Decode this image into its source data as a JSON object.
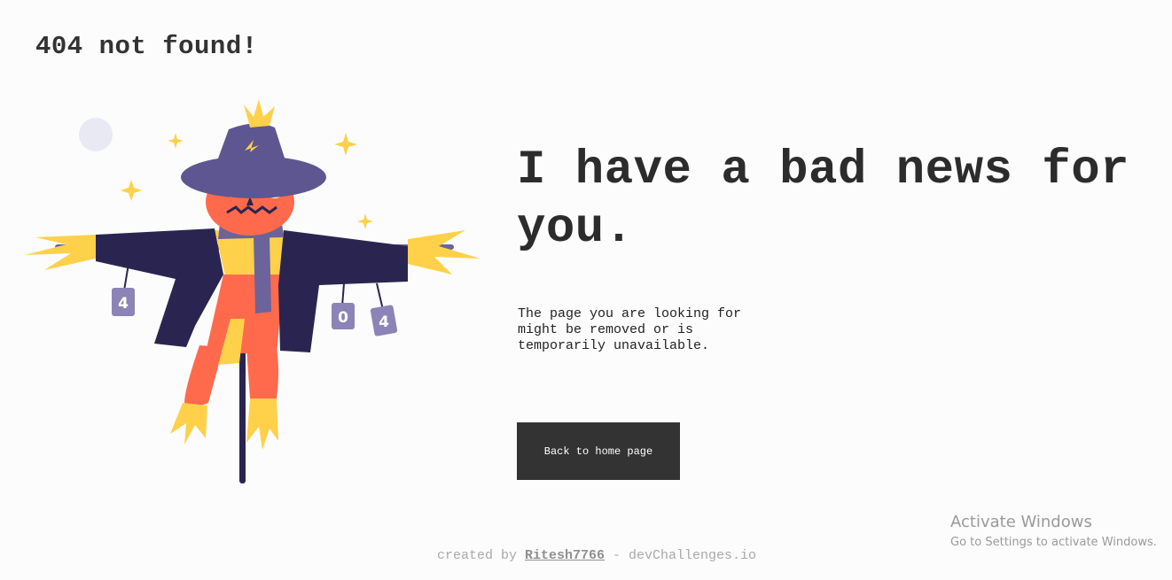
{
  "header": {
    "logo_text": "404 not found!"
  },
  "illustration": {
    "can_labels": [
      "4",
      "0",
      "4"
    ],
    "colors": {
      "hat": "#5e5690",
      "coat": "#2a2550",
      "face": "#ff6a4d",
      "straw": "#ffd14a",
      "scarf": "#6b6399",
      "moon": "#e9e9f3"
    }
  },
  "main": {
    "headline": "I have a bad news for you.",
    "description": "The page you are looking for might be removed or is temporarily unavailable.",
    "button_label": "Back to home page"
  },
  "footer": {
    "prefix": "created by ",
    "author": "Ritesh7766",
    "suffix": " - devChallenges.io"
  },
  "os_overlay": {
    "title": "Activate Windows",
    "subtitle": "Go to Settings to activate Windows."
  }
}
